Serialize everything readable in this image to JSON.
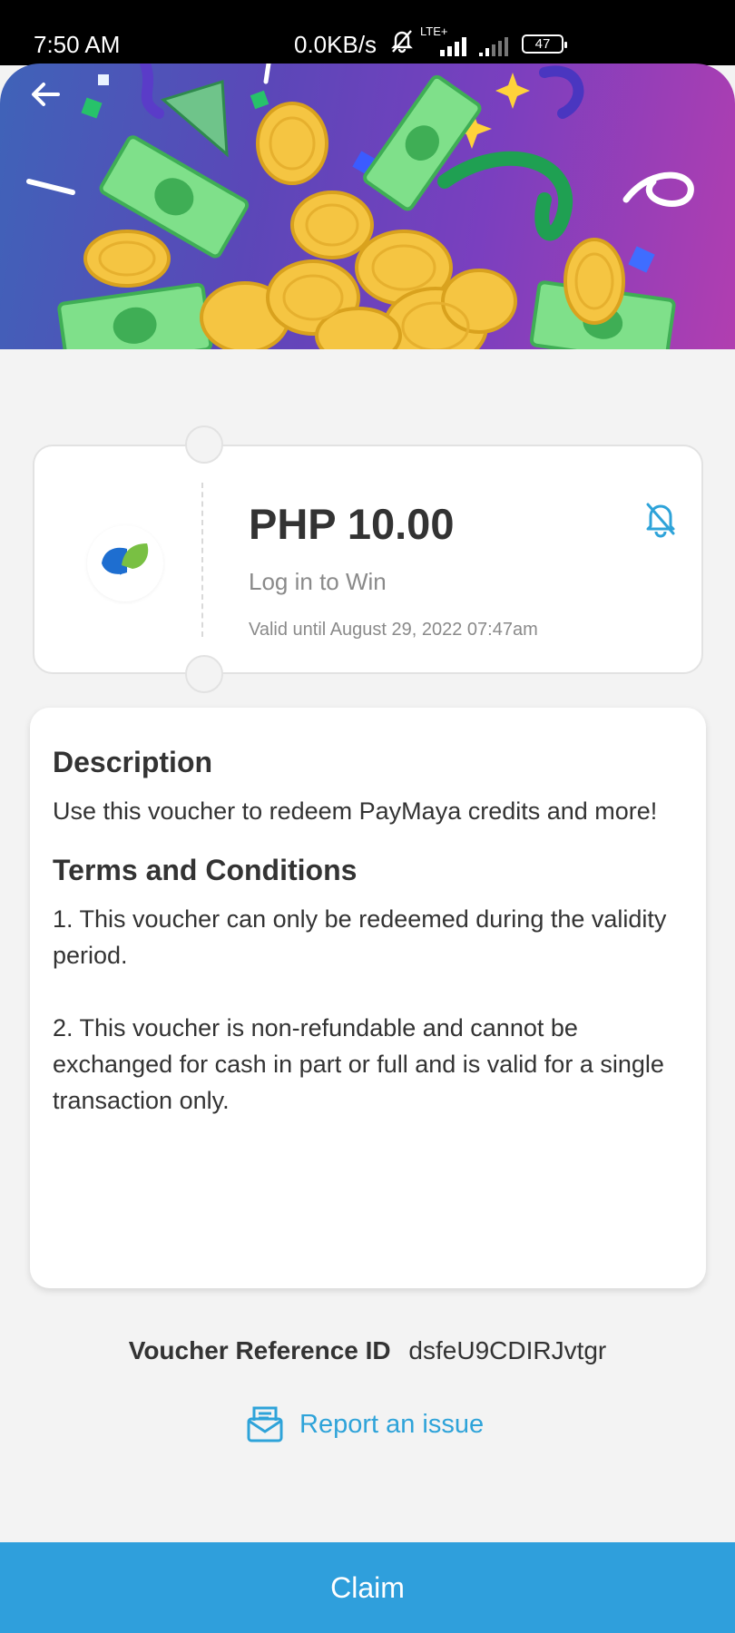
{
  "status_bar": {
    "time": "7:50 AM",
    "network_speed": "0.0KB/s",
    "network_type": "LTE+",
    "battery": "47",
    "icons": [
      "bell-muted-icon",
      "signal-icon",
      "signal-icon",
      "battery-icon"
    ]
  },
  "header": {
    "back_icon": "arrow-left-icon",
    "banner_art": "coins-and-cash-celebration"
  },
  "voucher": {
    "logo": "paymaya-logo",
    "amount": "PHP 10.00",
    "subtitle": "Log in to Win",
    "validity": "Valid until August 29, 2022 07:47am",
    "notify_icon": "bell-off-icon"
  },
  "details": {
    "description_title": "Description",
    "description_text": "Use this voucher to redeem PayMaya credits and more!",
    "terms_title": "Terms and Conditions",
    "terms": [
      "1. This voucher can only be redeemed during the validity period.",
      "2. This voucher is non-refundable and cannot be exchanged for cash in part or full and is valid for a single transaction only."
    ]
  },
  "reference": {
    "label": "Voucher Reference ID",
    "value": "dsfeU9CDIRJvtgr"
  },
  "report": {
    "label": "Report an issue",
    "icon": "mail-alert-icon"
  },
  "actions": {
    "claim_label": "Claim"
  },
  "colors": {
    "accent": "#2f9fdc",
    "link": "#2ea3d9",
    "background": "#f3f3f3",
    "banner_start": "#3f63b8",
    "banner_end": "#b13eb0"
  }
}
